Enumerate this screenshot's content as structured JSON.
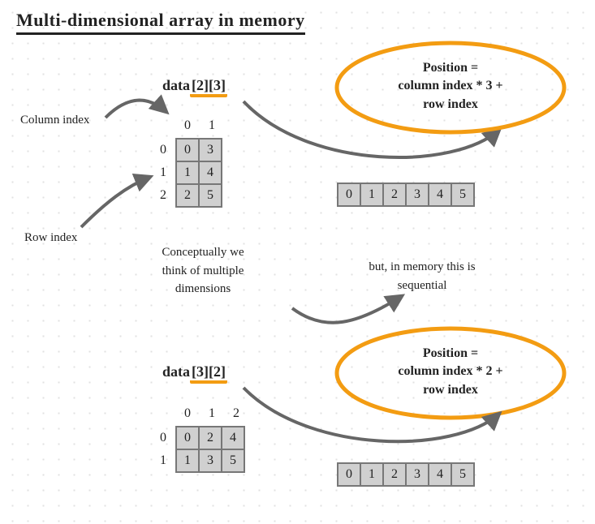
{
  "title": "Multi-dimensional array in memory",
  "example1": {
    "decl_prefix": "data",
    "decl_bracket": "[2][3]",
    "grid": {
      "col_headers": [
        "0",
        "1"
      ],
      "row_headers": [
        "0",
        "1",
        "2"
      ],
      "cells": [
        [
          "0",
          "3"
        ],
        [
          "1",
          "4"
        ],
        [
          "2",
          "5"
        ]
      ]
    },
    "memory": [
      "0",
      "1",
      "2",
      "3",
      "4",
      "5"
    ],
    "bubble": {
      "line1": "Position =",
      "line2": "column index * 3 +",
      "line3": "row index"
    }
  },
  "labels": {
    "column_index": "Column index",
    "row_index": "Row index",
    "conceptual_l1": "Conceptually we",
    "conceptual_l2": "think of multiple",
    "conceptual_l3": "dimensions",
    "memory_l1": "but, in memory this is",
    "memory_l2": "sequential"
  },
  "example2": {
    "decl_prefix": "data",
    "decl_bracket": "[3][2]",
    "grid": {
      "col_headers": [
        "0",
        "1",
        "2"
      ],
      "row_headers": [
        "0",
        "1"
      ],
      "cells": [
        [
          "0",
          "2",
          "4"
        ],
        [
          "1",
          "3",
          "5"
        ]
      ]
    },
    "memory": [
      "0",
      "1",
      "2",
      "3",
      "4",
      "5"
    ],
    "bubble": {
      "line1": "Position =",
      "line2": "column index * 2 +",
      "line3": "row index"
    }
  }
}
